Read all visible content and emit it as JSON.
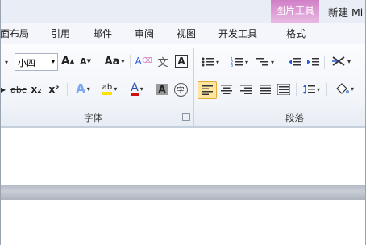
{
  "titlebar": {
    "context_tab_title": "图片工具",
    "doc_title": "新建 Mi"
  },
  "tabs": [
    {
      "label": "面布局"
    },
    {
      "label": "引用"
    },
    {
      "label": "邮件"
    },
    {
      "label": "审阅"
    },
    {
      "label": "视图"
    },
    {
      "label": "开发工具"
    },
    {
      "label": "格式"
    }
  ],
  "font_group": {
    "label": "字体",
    "font_size_value": "小四",
    "grow_font": "A",
    "shrink_font": "A",
    "change_case": "Aa",
    "clear_format": "A",
    "phonetic": "文",
    "char_border": "A",
    "strikethrough": "abc",
    "subscript": "x₂",
    "superscript": "x²",
    "text_effect": "A",
    "highlight": "ab",
    "font_color": "A",
    "char_shading": "A",
    "enclose_char": "字"
  },
  "paragraph_group": {
    "label": "段落"
  },
  "colors": {
    "accent_pink": "#d07fc6",
    "highlight_yellow": "#ffe000",
    "font_color_red": "#d01010",
    "active_button": "#ffe59e"
  }
}
